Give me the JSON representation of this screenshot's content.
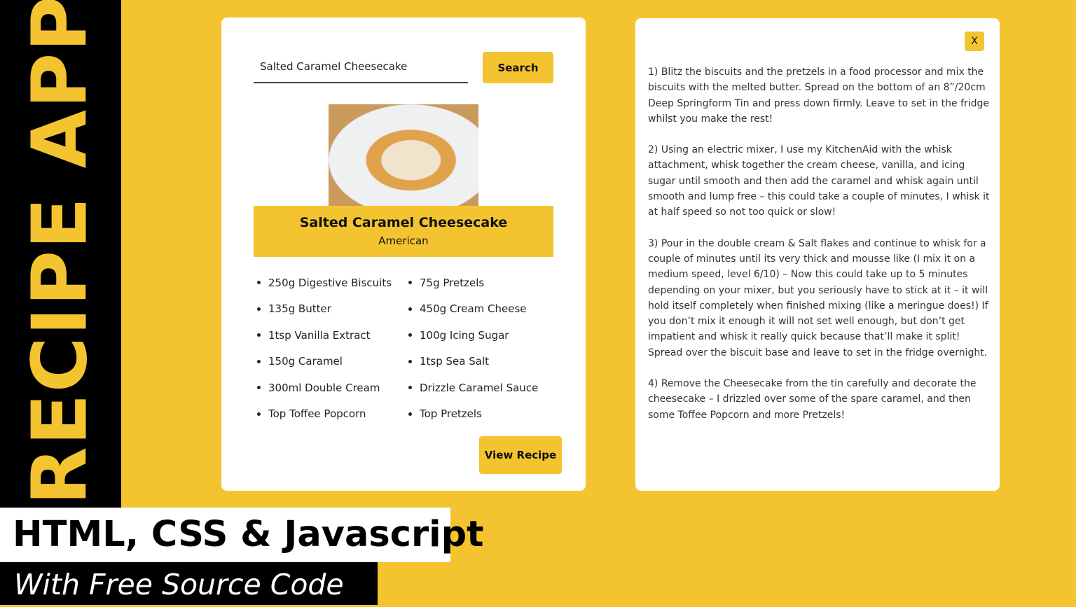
{
  "banner": {
    "vertical_title": "RECIPE APP",
    "tech_line": "HTML, CSS & Javascript",
    "source_line": "With Free Source Code"
  },
  "colors": {
    "accent": "#f4c430",
    "dark": "#000000"
  },
  "search": {
    "value": "Salted Caramel Cheesecake",
    "button_label": "Search"
  },
  "meal": {
    "name": "Salted Caramel Cheesecake",
    "area": "American",
    "ingredients": [
      "250g Digestive Biscuits",
      "75g Pretzels",
      "135g Butter",
      "450g Cream Cheese",
      "1tsp Vanilla Extract",
      "100g Icing Sugar",
      "150g Caramel",
      "1tsp Sea Salt",
      "300ml Double Cream",
      "Drizzle Caramel Sauce",
      "Top Toffee Popcorn",
      "Top Pretzels"
    ],
    "view_button_label": "View Recipe"
  },
  "recipe_modal": {
    "close_label": "X",
    "steps": [
      "1) Blitz the biscuits and the pretzels in a food processor and mix the biscuits with the melted butter. Spread on the bottom of an 8”/20cm Deep Springform Tin and press down firmly. Leave to set in the fridge whilst you make the rest!",
      "2) Using an electric mixer, I use my KitchenAid with the whisk attachment, whisk together the cream cheese, vanilla, and icing sugar until smooth and then add the caramel and whisk again until smooth and lump free – this could take a couple of minutes, I whisk it at half speed so not too quick or slow!",
      "3) Pour in the double cream & Salt flakes and continue to whisk for a couple of minutes until its very thick and mousse like (I mix it on a medium speed, level 6/10) – Now this could take up to 5 minutes depending on your mixer, but you seriously have to stick at it – it will hold itself completely when finished mixing (like a meringue does!) If you don’t mix it enough it will not set well enough, but don’t get impatient and whisk it really quick because that’ll make it split! Spread over the biscuit base and leave to set in the fridge overnight.",
      "4) Remove the Cheesecake from the tin carefully and decorate the cheesecake – I drizzled over some of the spare caramel, and then some Toffee Popcorn and more Pretzels!"
    ]
  }
}
